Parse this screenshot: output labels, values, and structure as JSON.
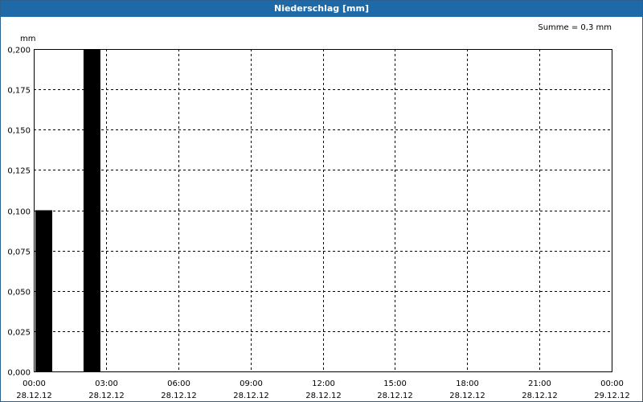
{
  "window": {
    "title": "Niederschlag [mm]"
  },
  "chart_data": {
    "type": "bar",
    "title": "Niederschlag [mm]",
    "ylabel": "mm",
    "annotation": "Summe = 0,3 mm",
    "ylim": [
      0,
      0.2
    ],
    "yticks": [
      {
        "value": 0.0,
        "label": "0,000"
      },
      {
        "value": 0.025,
        "label": "0,025"
      },
      {
        "value": 0.05,
        "label": "0,050"
      },
      {
        "value": 0.075,
        "label": "0,075"
      },
      {
        "value": 0.1,
        "label": "0,100"
      },
      {
        "value": 0.125,
        "label": "0,125"
      },
      {
        "value": 0.15,
        "label": "0,150"
      },
      {
        "value": 0.175,
        "label": "0,175"
      },
      {
        "value": 0.2,
        "label": "0,200"
      }
    ],
    "xlim_hours": [
      0,
      24
    ],
    "xticks": [
      {
        "hour": 0,
        "time": "00:00",
        "date": "28.12.12"
      },
      {
        "hour": 3,
        "time": "03:00",
        "date": "28.12.12"
      },
      {
        "hour": 6,
        "time": "06:00",
        "date": "28.12.12"
      },
      {
        "hour": 9,
        "time": "09:00",
        "date": "28.12.12"
      },
      {
        "hour": 12,
        "time": "12:00",
        "date": "28.12.12"
      },
      {
        "hour": 15,
        "time": "15:00",
        "date": "28.12.12"
      },
      {
        "hour": 18,
        "time": "18:00",
        "date": "28.12.12"
      },
      {
        "hour": 21,
        "time": "21:00",
        "date": "28.12.12"
      },
      {
        "hour": 24,
        "time": "00:00",
        "date": "29.12.12"
      }
    ],
    "bars": [
      {
        "start_hour": 0,
        "end_hour": 1,
        "value": 0.1
      },
      {
        "start_hour": 2,
        "end_hour": 3,
        "value": 0.2
      }
    ],
    "bar_color": "#000000",
    "grid": true
  }
}
